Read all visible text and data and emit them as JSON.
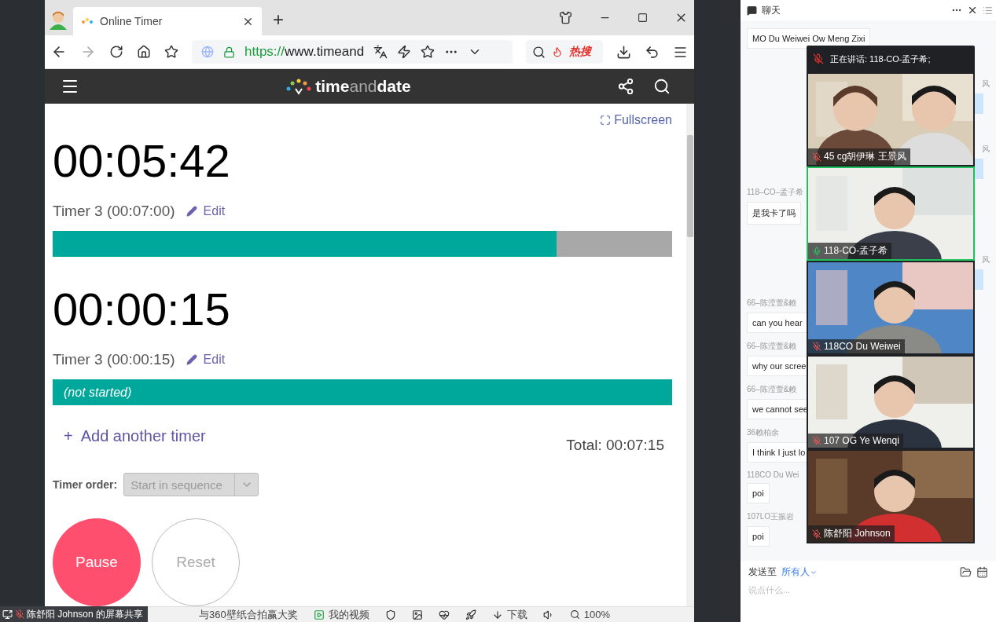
{
  "browser": {
    "tab_title": "Online Timer",
    "new_tab": "+",
    "url": {
      "scheme": "https://",
      "rest": "www.timeand"
    },
    "hot_search": "热搜"
  },
  "site": {
    "logo": [
      "time",
      "and",
      "date"
    ]
  },
  "page": {
    "fullscreen": "Fullscreen",
    "timers": [
      {
        "time": "00:05:42",
        "label": "Timer 3 (00:07:00)",
        "edit": "Edit",
        "level": 0.814
      },
      {
        "time": "00:00:15",
        "label": "Timer 3 (00:00:15)",
        "edit": "Edit",
        "level": 1,
        "bar_text": "(not started)"
      }
    ],
    "add_icon": "+",
    "add_timer": "Add another timer",
    "total": "Total: 00:07:15",
    "order": {
      "label": "Timer order:",
      "value": "Start in sequence",
      "disabled": true
    },
    "buttons": [
      {
        "label": "Pause",
        "kind": "primary"
      },
      {
        "label": "Reset",
        "kind": "secondary"
      }
    ]
  },
  "status_bar": {
    "promo": "与360壁纸合拍赢大奖",
    "videos": "我的视频",
    "download": "下载",
    "zoom": "100%"
  },
  "share_label": "陈舒阳 Johnson 的屏幕共享",
  "chat": {
    "title": "聊天",
    "messages": [
      {
        "kind": "left",
        "text": "MO Du Weiwei Ow Meng Zixi"
      },
      {
        "kind": "right",
        "sender": "风"
      },
      {
        "kind": "right",
        "sender": "风"
      },
      {
        "kind": "left",
        "sender": "118–CO–孟子希",
        "text": "是我卡了吗"
      },
      {
        "kind": "right",
        "sender": "风"
      },
      {
        "kind": "left",
        "sender": "66–陈滢萱&赖",
        "text": "can you hear"
      },
      {
        "kind": "left",
        "sender": "66–陈滢萱&赖",
        "text": "why our scree"
      },
      {
        "kind": "left",
        "sender": "66–陈滢萱&赖",
        "text": "we cannot see"
      },
      {
        "kind": "left",
        "sender": "36赖柏余",
        "text": "I think I just lo"
      },
      {
        "kind": "left",
        "sender": "118CO Du Wei",
        "text": "poi"
      },
      {
        "kind": "left",
        "sender": "107LO王振岩",
        "text": "poi"
      }
    ],
    "send_to": {
      "label": "发送至",
      "value": "所有人"
    },
    "placeholder": "说点什么..."
  },
  "video": {
    "speaking": "正在讲话: 118-CO-孟子希;",
    "tiles": [
      {
        "name": "45 cg胡伊琳 王景风",
        "muted": true,
        "active": false
      },
      {
        "name": "118-CO-孟子希",
        "muted": false,
        "active": true
      },
      {
        "name": "118CO Du Weiwei",
        "muted": true,
        "active": false
      },
      {
        "name": "107 OG Ye Wenqi",
        "muted": true,
        "active": false
      },
      {
        "name": "陈舒阳 Johnson",
        "muted": true,
        "active": false
      }
    ]
  }
}
